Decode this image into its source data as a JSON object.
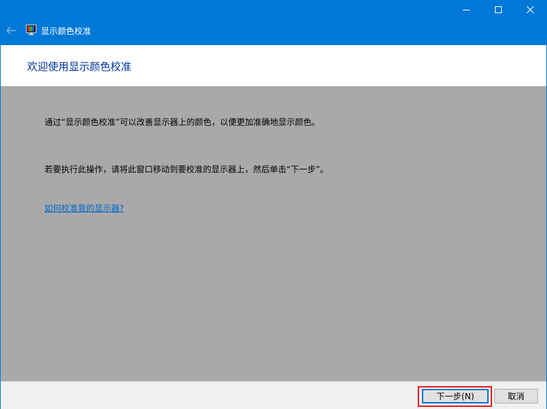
{
  "window": {
    "title": "显示颜色校准",
    "caption": {
      "minimize_icon": "minimize-icon",
      "maximize_icon": "maximize-icon",
      "close_icon": "close-icon"
    },
    "back_icon": "back-arrow-icon",
    "app_icon": "display-calibration-icon"
  },
  "header": {
    "heading": "欢迎使用显示颜色校准"
  },
  "content": {
    "paragraph1": "通过“显示颜色校准”可以改善显示器上的颜色，以便更加准确地显示颜色。",
    "paragraph2": "若要执行此操作，请将此窗口移动到要校准的显示器上，然后单击“下一步”。",
    "help_link": "如何校准我的显示器?"
  },
  "footer": {
    "next_label": "下一步(N)",
    "cancel_label": "取消"
  },
  "colors": {
    "titlebar": "#0078d7",
    "content_bg": "#a9a9a9",
    "heading": "#003399",
    "link": "#0066cc",
    "highlight": "#e02020"
  }
}
